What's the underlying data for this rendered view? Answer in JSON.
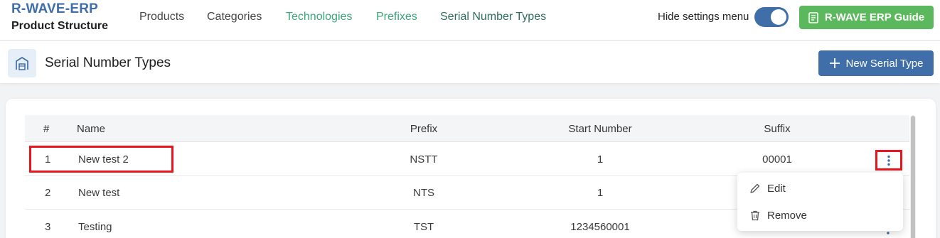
{
  "brand": {
    "title": "R-WAVE-ERP",
    "subtitle": "Product Structure"
  },
  "nav": {
    "items": [
      {
        "label": "Products"
      },
      {
        "label": "Categories"
      },
      {
        "label": "Technologies"
      },
      {
        "label": "Prefixes"
      },
      {
        "label": "Serial Number Types"
      }
    ]
  },
  "settings": {
    "hide_label": "Hide settings menu",
    "toggle_on": true
  },
  "guide_button": {
    "label": "R-WAVE ERP Guide",
    "icon": "document-icon"
  },
  "page": {
    "title": "Serial Number Types",
    "icon": "warehouse-icon"
  },
  "new_button": {
    "label": "New Serial Type",
    "icon": "plus-icon"
  },
  "table": {
    "columns": [
      "#",
      "Name",
      "Prefix",
      "Start Number",
      "Suffix"
    ],
    "rows": [
      {
        "index": "1",
        "name": "New test 2",
        "prefix": "NSTT",
        "start": "1",
        "suffix": "00001"
      },
      {
        "index": "2",
        "name": "New test",
        "prefix": "NTS",
        "start": "1",
        "suffix": ""
      },
      {
        "index": "3",
        "name": "Testing",
        "prefix": "TST",
        "start": "1234560001",
        "suffix": ""
      }
    ]
  },
  "row_menu": {
    "items": [
      {
        "label": "Edit",
        "icon": "pencil-icon"
      },
      {
        "label": "Remove",
        "icon": "trash-icon"
      }
    ]
  },
  "colors": {
    "brand_blue": "#3f6ea8",
    "nav_green": "#3aa679",
    "guide_green": "#5cb85c",
    "highlight_red": "#e8151c"
  }
}
